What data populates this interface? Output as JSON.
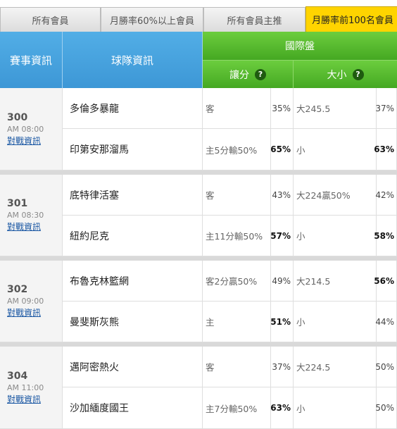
{
  "tabs": [
    {
      "label": "所有會員",
      "active": false
    },
    {
      "label": "月勝率60%以上會員",
      "active": false
    },
    {
      "label": "所有會員主推",
      "active": false
    },
    {
      "label": "月勝率前100名會員",
      "active": true
    }
  ],
  "header": {
    "event_info": "賽事資訊",
    "team_info": "球隊資訊",
    "intl_market": "國際盤",
    "handicap": "讓分",
    "over_under": "大小",
    "help_mark": "?"
  },
  "games": [
    {
      "number": "300",
      "time": "AM 08:00",
      "link": "對戰資訊",
      "rows": [
        {
          "team": "多倫多暴龍",
          "handicap": "客",
          "handicap_pct": "35%",
          "handicap_pct_bold": false,
          "ou": "大245.5",
          "ou_pct": "37%",
          "ou_pct_bold": false
        },
        {
          "team": "印第安那溜馬",
          "handicap": "主5分輸50%",
          "handicap_pct": "65%",
          "handicap_pct_bold": true,
          "ou": "小",
          "ou_pct": "63%",
          "ou_pct_bold": true
        }
      ]
    },
    {
      "number": "301",
      "time": "AM 08:30",
      "link": "對戰資訊",
      "rows": [
        {
          "team": "底特律活塞",
          "handicap": "客",
          "handicap_pct": "43%",
          "handicap_pct_bold": false,
          "ou": "大224贏50%",
          "ou_pct": "42%",
          "ou_pct_bold": false
        },
        {
          "team": "紐約尼克",
          "handicap": "主11分輸50%",
          "handicap_pct": "57%",
          "handicap_pct_bold": true,
          "ou": "小",
          "ou_pct": "58%",
          "ou_pct_bold": true
        }
      ]
    },
    {
      "number": "302",
      "time": "AM 09:00",
      "link": "對戰資訊",
      "rows": [
        {
          "team": "布魯克林籃網",
          "handicap": "客2分贏50%",
          "handicap_pct": "49%",
          "handicap_pct_bold": false,
          "ou": "大214.5",
          "ou_pct": "56%",
          "ou_pct_bold": true
        },
        {
          "team": "曼斐斯灰熊",
          "handicap": "主",
          "handicap_pct": "51%",
          "handicap_pct_bold": true,
          "ou": "小",
          "ou_pct": "44%",
          "ou_pct_bold": false
        }
      ]
    },
    {
      "number": "304",
      "time": "AM 11:00",
      "link": "對戰資訊",
      "rows": [
        {
          "team": "邁阿密熱火",
          "handicap": "客",
          "handicap_pct": "37%",
          "handicap_pct_bold": false,
          "ou": "大224.5",
          "ou_pct": "50%",
          "ou_pct_bold": false
        },
        {
          "team": "沙加緬度國王",
          "handicap": "主7分輸50%",
          "handicap_pct": "63%",
          "handicap_pct_bold": true,
          "ou": "小",
          "ou_pct": "50%",
          "ou_pct_bold": false
        }
      ]
    }
  ]
}
